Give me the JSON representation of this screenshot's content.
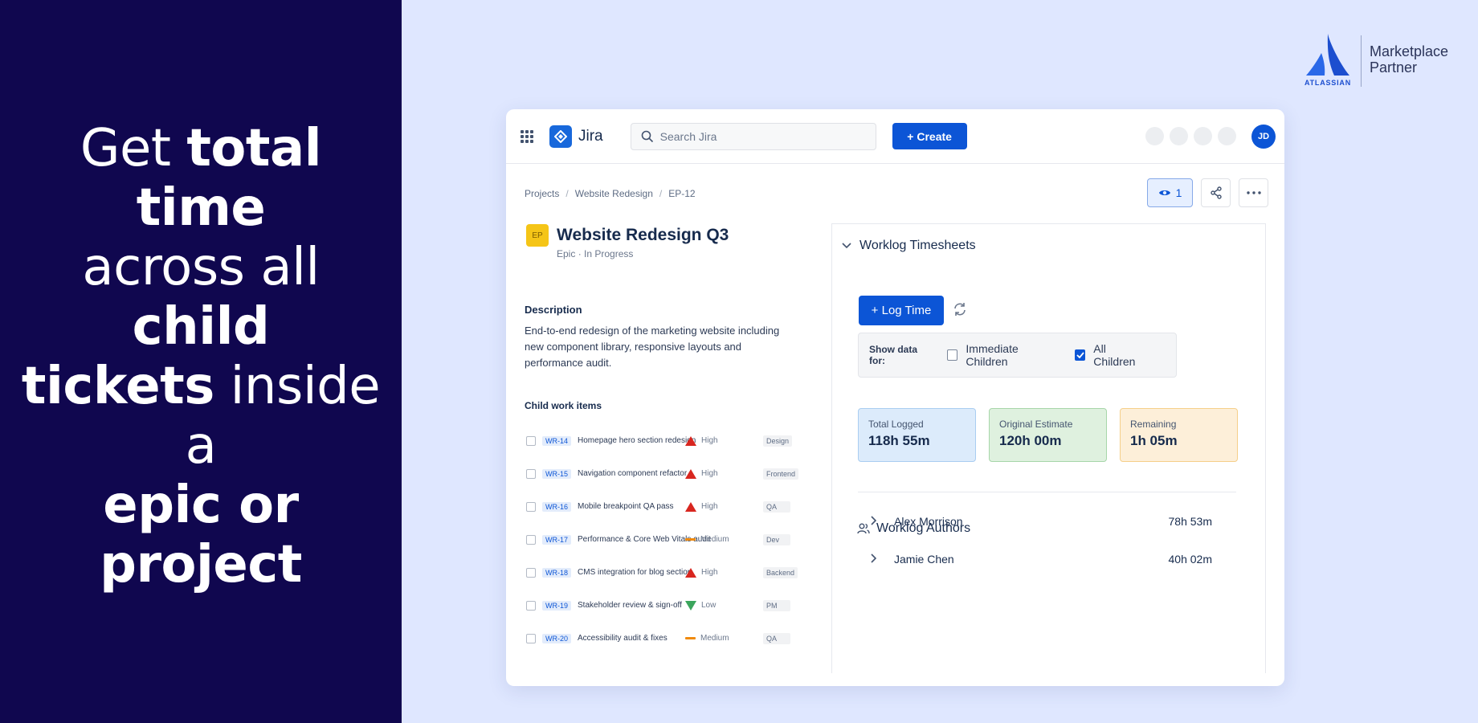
{
  "promo": {
    "l1_a": "Get ",
    "l1_b": "total time",
    "l2_a": "across all ",
    "l2_b": "child",
    "l3_a": "tickets",
    "l3_b": " inside a",
    "l4": "epic or project"
  },
  "badge": {
    "logo_text": "ATLASSIAN",
    "line1": "Marketplace",
    "line2": "Partner"
  },
  "topbar": {
    "app_name": "Jira",
    "search_placeholder": "Search Jira",
    "create_label": "+ Create",
    "avatar_initials": "JD"
  },
  "breadcrumb": [
    "Projects",
    "Website Redesign",
    "EP-12"
  ],
  "watchers_count": "1",
  "issue": {
    "chip": "EP",
    "title": "Website Redesign Q3",
    "type": "Epic",
    "status": "In Progress",
    "description_heading": "Description",
    "description": "End-to-end redesign of the marketing website including new component library, responsive layouts and performance audit."
  },
  "child_items": {
    "heading": "Child work items",
    "rows": [
      {
        "key": "WR-14",
        "summary": "Homepage hero section redesign",
        "priority": "High",
        "tag": "Design"
      },
      {
        "key": "WR-15",
        "summary": "Navigation component refactor",
        "priority": "High",
        "tag": "Frontend"
      },
      {
        "key": "WR-16",
        "summary": "Mobile breakpoint QA pass",
        "priority": "High",
        "tag": "QA"
      },
      {
        "key": "WR-17",
        "summary": "Performance & Core Web Vitals audit",
        "priority": "Medium",
        "tag": "Dev"
      },
      {
        "key": "WR-18",
        "summary": "CMS integration for blog section",
        "priority": "High",
        "tag": "Backend"
      },
      {
        "key": "WR-19",
        "summary": "Stakeholder review & sign-off",
        "priority": "Low",
        "tag": "PM"
      },
      {
        "key": "WR-20",
        "summary": "Accessibility audit & fixes",
        "priority": "Medium",
        "tag": "QA"
      }
    ]
  },
  "worklog": {
    "title": "Worklog Timesheets",
    "log_time_label": "+ Log Time",
    "filter_label": "Show data for:",
    "option_immediate": "Immediate Children",
    "option_all": "All Children",
    "option_all_checked": true,
    "stats": {
      "total_label": "Total Logged",
      "total_value": "118h 55m",
      "estimate_label": "Original Estimate",
      "estimate_value": "120h 00m",
      "remaining_label": "Remaining",
      "remaining_value": "1h 05m"
    },
    "authors_heading": "Worklog Authors",
    "authors": [
      {
        "name": "Alex Morrison",
        "hours": "78h 53m"
      },
      {
        "name": "Jamie Chen",
        "hours": "40h 02m"
      }
    ]
  },
  "colors": {
    "promo_bg": "#10074f",
    "page_bg": "#dfe7ff",
    "primary": "#0c55d6",
    "priority_high": "#d8261f",
    "priority_medium": "#f08a0c",
    "priority_low": "#3ba55c"
  }
}
